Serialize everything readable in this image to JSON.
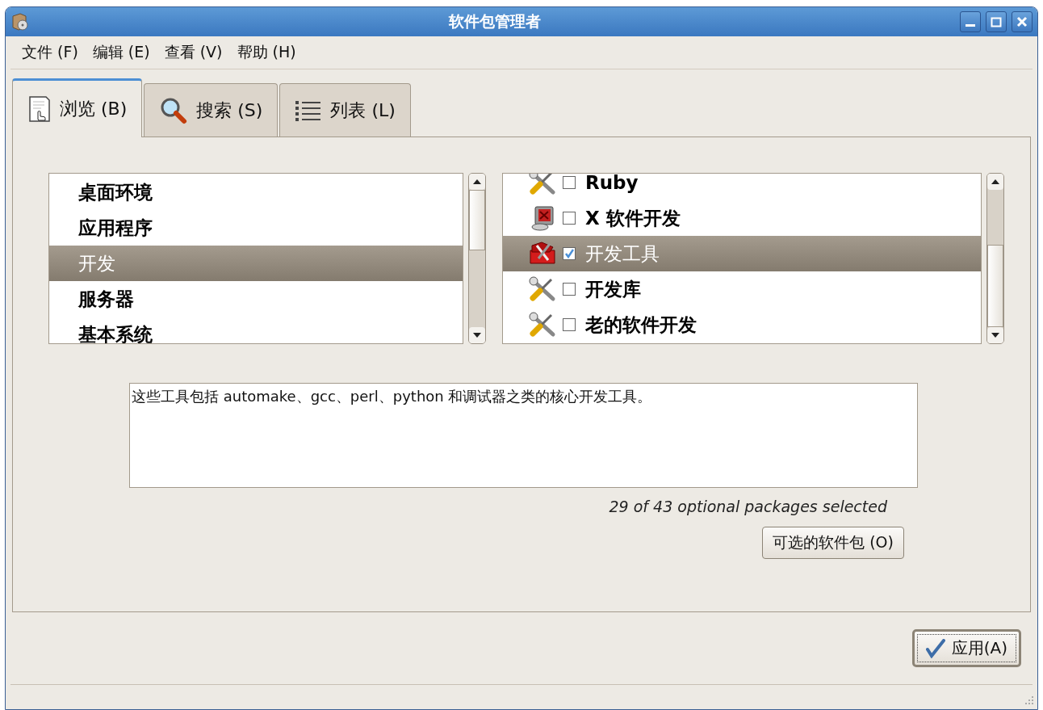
{
  "window": {
    "title": "软件包管理者"
  },
  "menu": [
    "文件 (F)",
    "编辑 (E)",
    "查看 (V)",
    "帮助 (H)"
  ],
  "tabs": [
    {
      "label": "浏览 (B)",
      "kind": "browse",
      "selected": true
    },
    {
      "label": "搜索 (S)",
      "kind": "search",
      "selected": false
    },
    {
      "label": "列表 (L)",
      "kind": "list",
      "selected": false
    }
  ],
  "categories": [
    {
      "label": "桌面环境",
      "selected": false
    },
    {
      "label": "应用程序",
      "selected": false
    },
    {
      "label": "开发",
      "selected": true
    },
    {
      "label": "服务器",
      "selected": false
    },
    {
      "label": "基本系统",
      "selected": false
    }
  ],
  "groups": [
    {
      "label": "Ruby",
      "kind": "tools",
      "checked": false,
      "selected": false
    },
    {
      "label": "X 软件开发",
      "kind": "monitor",
      "checked": false,
      "selected": false
    },
    {
      "label": "开发工具",
      "kind": "toolbox",
      "checked": true,
      "selected": true
    },
    {
      "label": "开发库",
      "kind": "tools",
      "checked": false,
      "selected": false
    },
    {
      "label": "老的软件开发",
      "kind": "tools",
      "checked": false,
      "selected": false
    }
  ],
  "description": "这些工具包括 automake、gcc、perl、python 和调试器之类的核心开发工具。",
  "status": "29 of 43 optional packages selected",
  "optional_button": "可选的软件包 (O)",
  "apply_button": "应用(A)"
}
